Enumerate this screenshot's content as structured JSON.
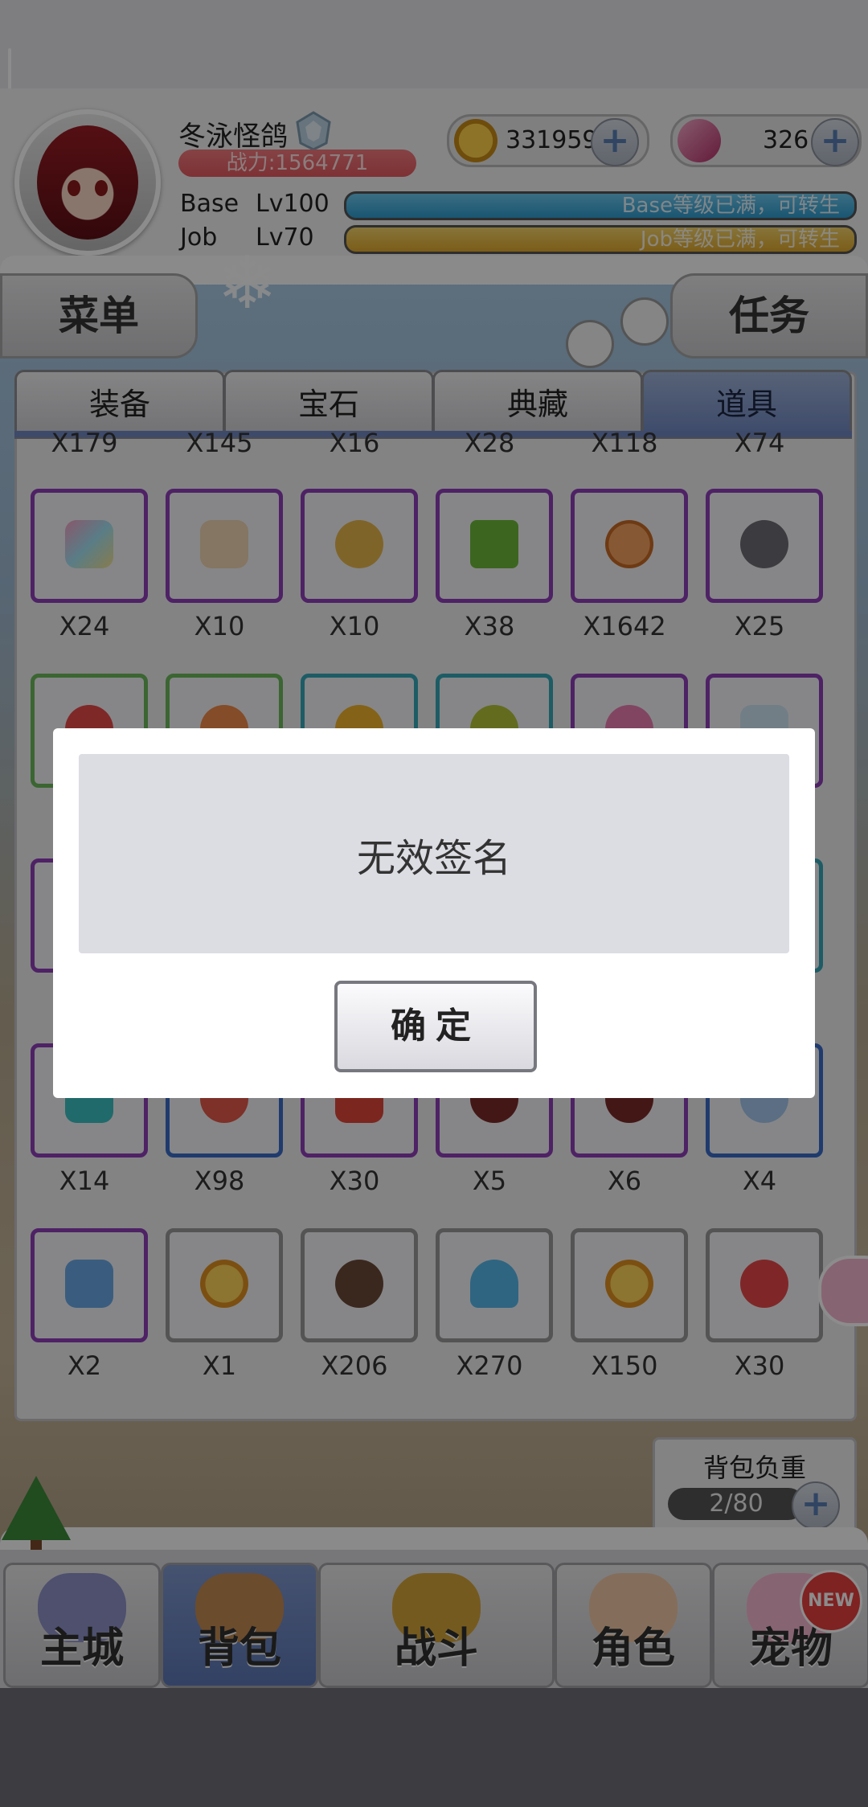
{
  "player": {
    "name": "冬泳怪鸽",
    "power": "战力:1564771",
    "base_label": "Base",
    "base_level": "Lv100",
    "base_status": "Base等级已满，可转生",
    "base_progress": 1.0,
    "job_label": "Job",
    "job_level": "Lv70",
    "job_status": "Job等级已满，可转生",
    "job_progress": 1.0
  },
  "currency": {
    "gold": "331959",
    "gems": "326",
    "plus_symbol": "+"
  },
  "side_buttons": {
    "menu": "菜单",
    "task": "任务"
  },
  "tabs": [
    "装备",
    "宝石",
    "典藏",
    "道具"
  ],
  "inventory": {
    "top_partial_counts": [
      "X179",
      "X145",
      "X16",
      "X28",
      "X118",
      "X74"
    ],
    "row1_counts": [
      "X24",
      "X10",
      "X10",
      "X38",
      "X1642",
      "X25"
    ],
    "row4_counts": [
      "X14",
      "X98",
      "X30",
      "X5",
      "X6",
      "X4"
    ],
    "row5_counts": [
      "X2",
      "X1",
      "X206",
      "X270",
      "X150",
      "X30"
    ]
  },
  "weight": {
    "label": "背包负重",
    "value": "2/80"
  },
  "nav": {
    "main_city": "主城",
    "backpack": "背包",
    "battle": "战斗",
    "character": "角色",
    "pet": "宠物",
    "new_badge": "NEW"
  },
  "dialog": {
    "message": "无效签名",
    "confirm": "确定"
  },
  "colors": {
    "base_bar": "#37a7d8",
    "job_bar": "#e9b63c",
    "dialog_bg": "#ffffff",
    "dialog_msg_bg": "#dcdce3",
    "rarity_purple": "#8f3fb9",
    "rarity_green": "#6cb85a",
    "rarity_teal": "#35a8b9",
    "rarity_blue": "#3a6cc8"
  }
}
